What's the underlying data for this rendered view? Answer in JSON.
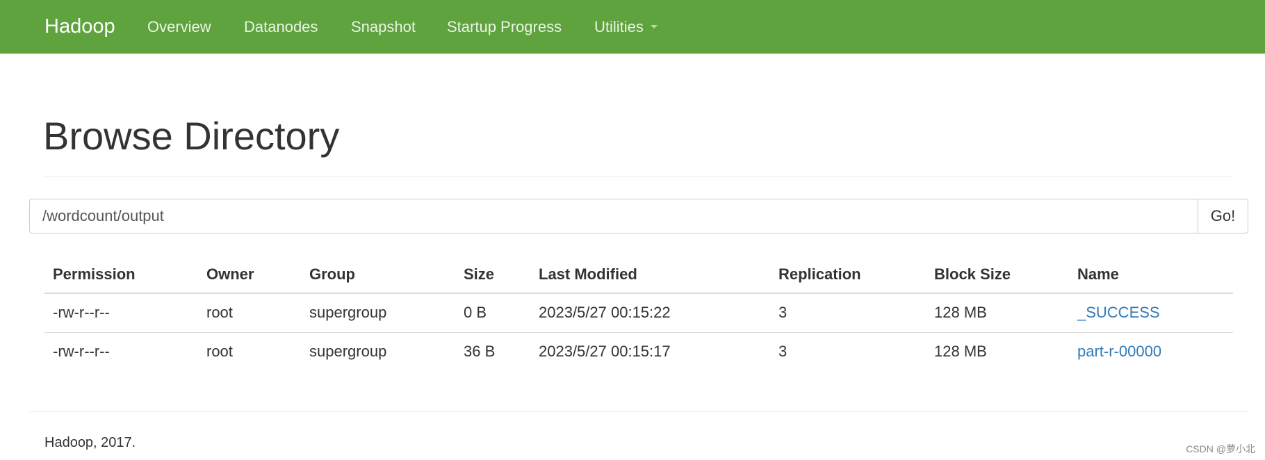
{
  "navbar": {
    "brand": "Hadoop",
    "items": [
      {
        "label": "Overview"
      },
      {
        "label": "Datanodes"
      },
      {
        "label": "Snapshot"
      },
      {
        "label": "Startup Progress"
      },
      {
        "label": "Utilities"
      }
    ],
    "background_color": "#5fa33e"
  },
  "page": {
    "title": "Browse Directory"
  },
  "path_bar": {
    "value": "/wordcount/output",
    "go_label": "Go!"
  },
  "table": {
    "headers": [
      "Permission",
      "Owner",
      "Group",
      "Size",
      "Last Modified",
      "Replication",
      "Block Size",
      "Name"
    ],
    "rows": [
      {
        "permission": "-rw-r--r--",
        "owner": "root",
        "group": "supergroup",
        "size": "0 B",
        "last_modified": "2023/5/27 00:15:22",
        "replication": "3",
        "block_size": "128 MB",
        "name": "_SUCCESS"
      },
      {
        "permission": "-rw-r--r--",
        "owner": "root",
        "group": "supergroup",
        "size": "36 B",
        "last_modified": "2023/5/27 00:15:17",
        "replication": "3",
        "block_size": "128 MB",
        "name": "part-r-00000"
      }
    ],
    "link_color": "#337ab7"
  },
  "footer": {
    "text": "Hadoop, 2017."
  },
  "watermark": "CSDN @萝小北"
}
